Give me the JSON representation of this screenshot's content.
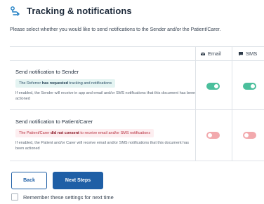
{
  "header": {
    "title": "Tracking & notifications",
    "icon": "tracking-icon"
  },
  "intro": "Please select whether you would like to send notifications to the Sender and/or the Patient/Carer.",
  "columns": {
    "email": {
      "label": "Email",
      "icon": "envelope-icon"
    },
    "sms": {
      "label": "SMS",
      "icon": "message-icon"
    }
  },
  "rows": [
    {
      "title": "Send notification to Sender",
      "status_prefix": "The Referrer ",
      "status_bold": "has requested",
      "status_suffix": " tracking and notifications",
      "note": "If enabled, the Sender will receive in app and email and/or SMS notifications that this document has been actioned",
      "email_enabled": true,
      "sms_enabled": true
    },
    {
      "title": "Send notification to Patient/Carer",
      "status_prefix": "The Patient/Carer ",
      "status_bold": "did not consent",
      "status_suffix": " to receive email and/or SMS notifications",
      "note": "If enabled, the Patient and/or Carer will receive email and/or SMS notifications that this document has been actioned",
      "email_enabled": false,
      "sms_enabled": false
    }
  ],
  "buttons": {
    "back": "Back",
    "next": "Next Steps"
  },
  "remember": {
    "label": "Remember these settings for next time",
    "checked": false
  },
  "colors": {
    "primary": "#1f5fa6",
    "toggle_on": "#4bbf9c",
    "toggle_off": "#f2a9ad"
  }
}
